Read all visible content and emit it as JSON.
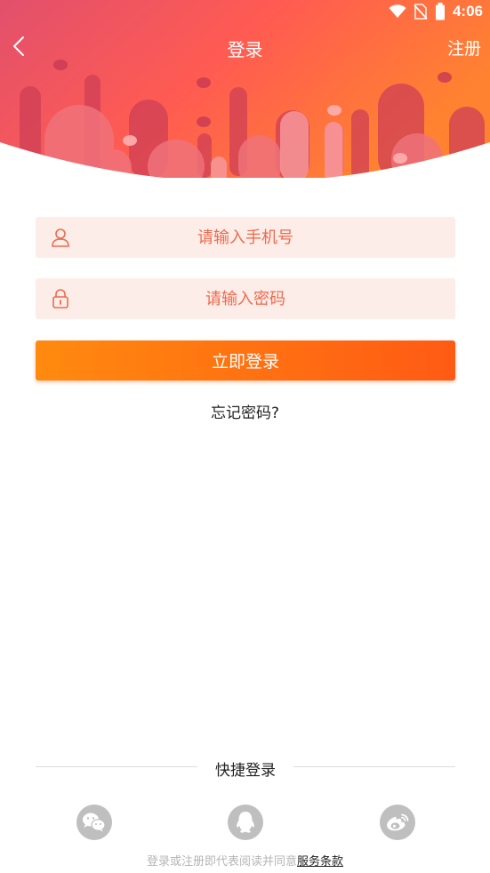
{
  "status_bar": {
    "time": "4:06",
    "icons": [
      "wifi-icon",
      "no-sim-icon",
      "battery-icon"
    ]
  },
  "nav": {
    "title": "登录",
    "register_label": "注册",
    "back_icon": "chevron-left-icon"
  },
  "form": {
    "phone_placeholder": "请输入手机号",
    "password_placeholder": "请输入密码",
    "phone_icon": "user-icon",
    "password_icon": "lock-icon",
    "login_button": "立即登录",
    "forgot_password": "忘记密码?"
  },
  "quick_login": {
    "title": "快捷登录",
    "providers": [
      "wechat-icon",
      "qq-icon",
      "weibo-icon"
    ]
  },
  "agreement": {
    "prefix": "登录或注册即代表阅读并同意",
    "link": "服务条款"
  },
  "colors": {
    "header_gradient": [
      "#e2526e",
      "#ff5a50",
      "#ff7e32"
    ],
    "accent": "#ff6a10",
    "placeholder": "#ee6a4e",
    "field_bg": "#fdede8"
  }
}
